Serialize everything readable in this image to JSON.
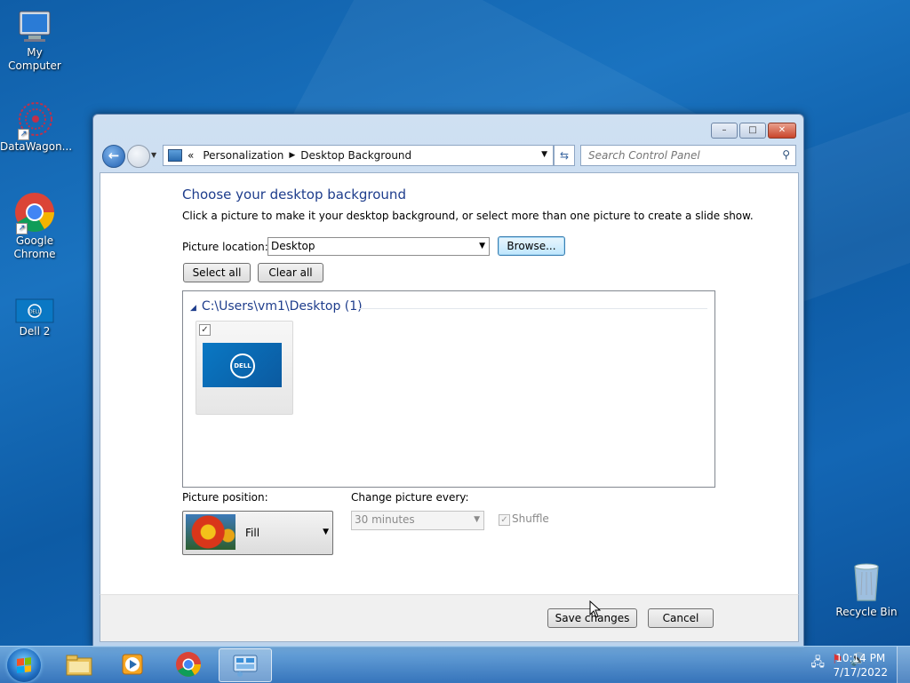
{
  "desktop": {
    "icons": [
      {
        "label": "My Computer",
        "icon": "computer-icon"
      },
      {
        "label": "DataWagon...",
        "icon": "datawagon-icon"
      },
      {
        "label": "Google Chrome",
        "icon": "chrome-icon"
      },
      {
        "label": "Dell 2",
        "icon": "dell-image-icon"
      },
      {
        "label": "Recycle Bin",
        "icon": "recycle-bin-icon"
      }
    ]
  },
  "window": {
    "caption_buttons": {
      "minimize": "–",
      "maximize": "□",
      "close": "✕"
    },
    "breadcrumb": {
      "prefix": "«",
      "items": [
        "Personalization",
        "Desktop Background"
      ]
    },
    "search_placeholder": "Search Control Panel",
    "heading": "Choose your desktop background",
    "description": "Click a picture to make it your desktop background, or select more than one picture to create a slide show.",
    "picture_location": {
      "label": "Picture location:",
      "value": "Desktop"
    },
    "browse_label": "Browse...",
    "select_all_label": "Select all",
    "clear_all_label": "Clear all",
    "gallery": {
      "group_label": "C:\\Users\\vm1\\Desktop (1)",
      "items": [
        {
          "checked": true,
          "icon": "dell-wallpaper"
        }
      ]
    },
    "picture_position": {
      "label": "Picture position:",
      "value": "Fill"
    },
    "change_every": {
      "label": "Change picture every:",
      "value": "30 minutes"
    },
    "shuffle": {
      "label": "Shuffle",
      "checked": true,
      "enabled": false
    },
    "save_label": "Save changes",
    "cancel_label": "Cancel"
  },
  "taskbar": {
    "apps": [
      "file-explorer-icon",
      "media-player-icon",
      "chrome-icon",
      "control-panel-icon"
    ],
    "active_app": "control-panel-icon",
    "time": "10:14 PM",
    "date": "7/17/2022"
  }
}
